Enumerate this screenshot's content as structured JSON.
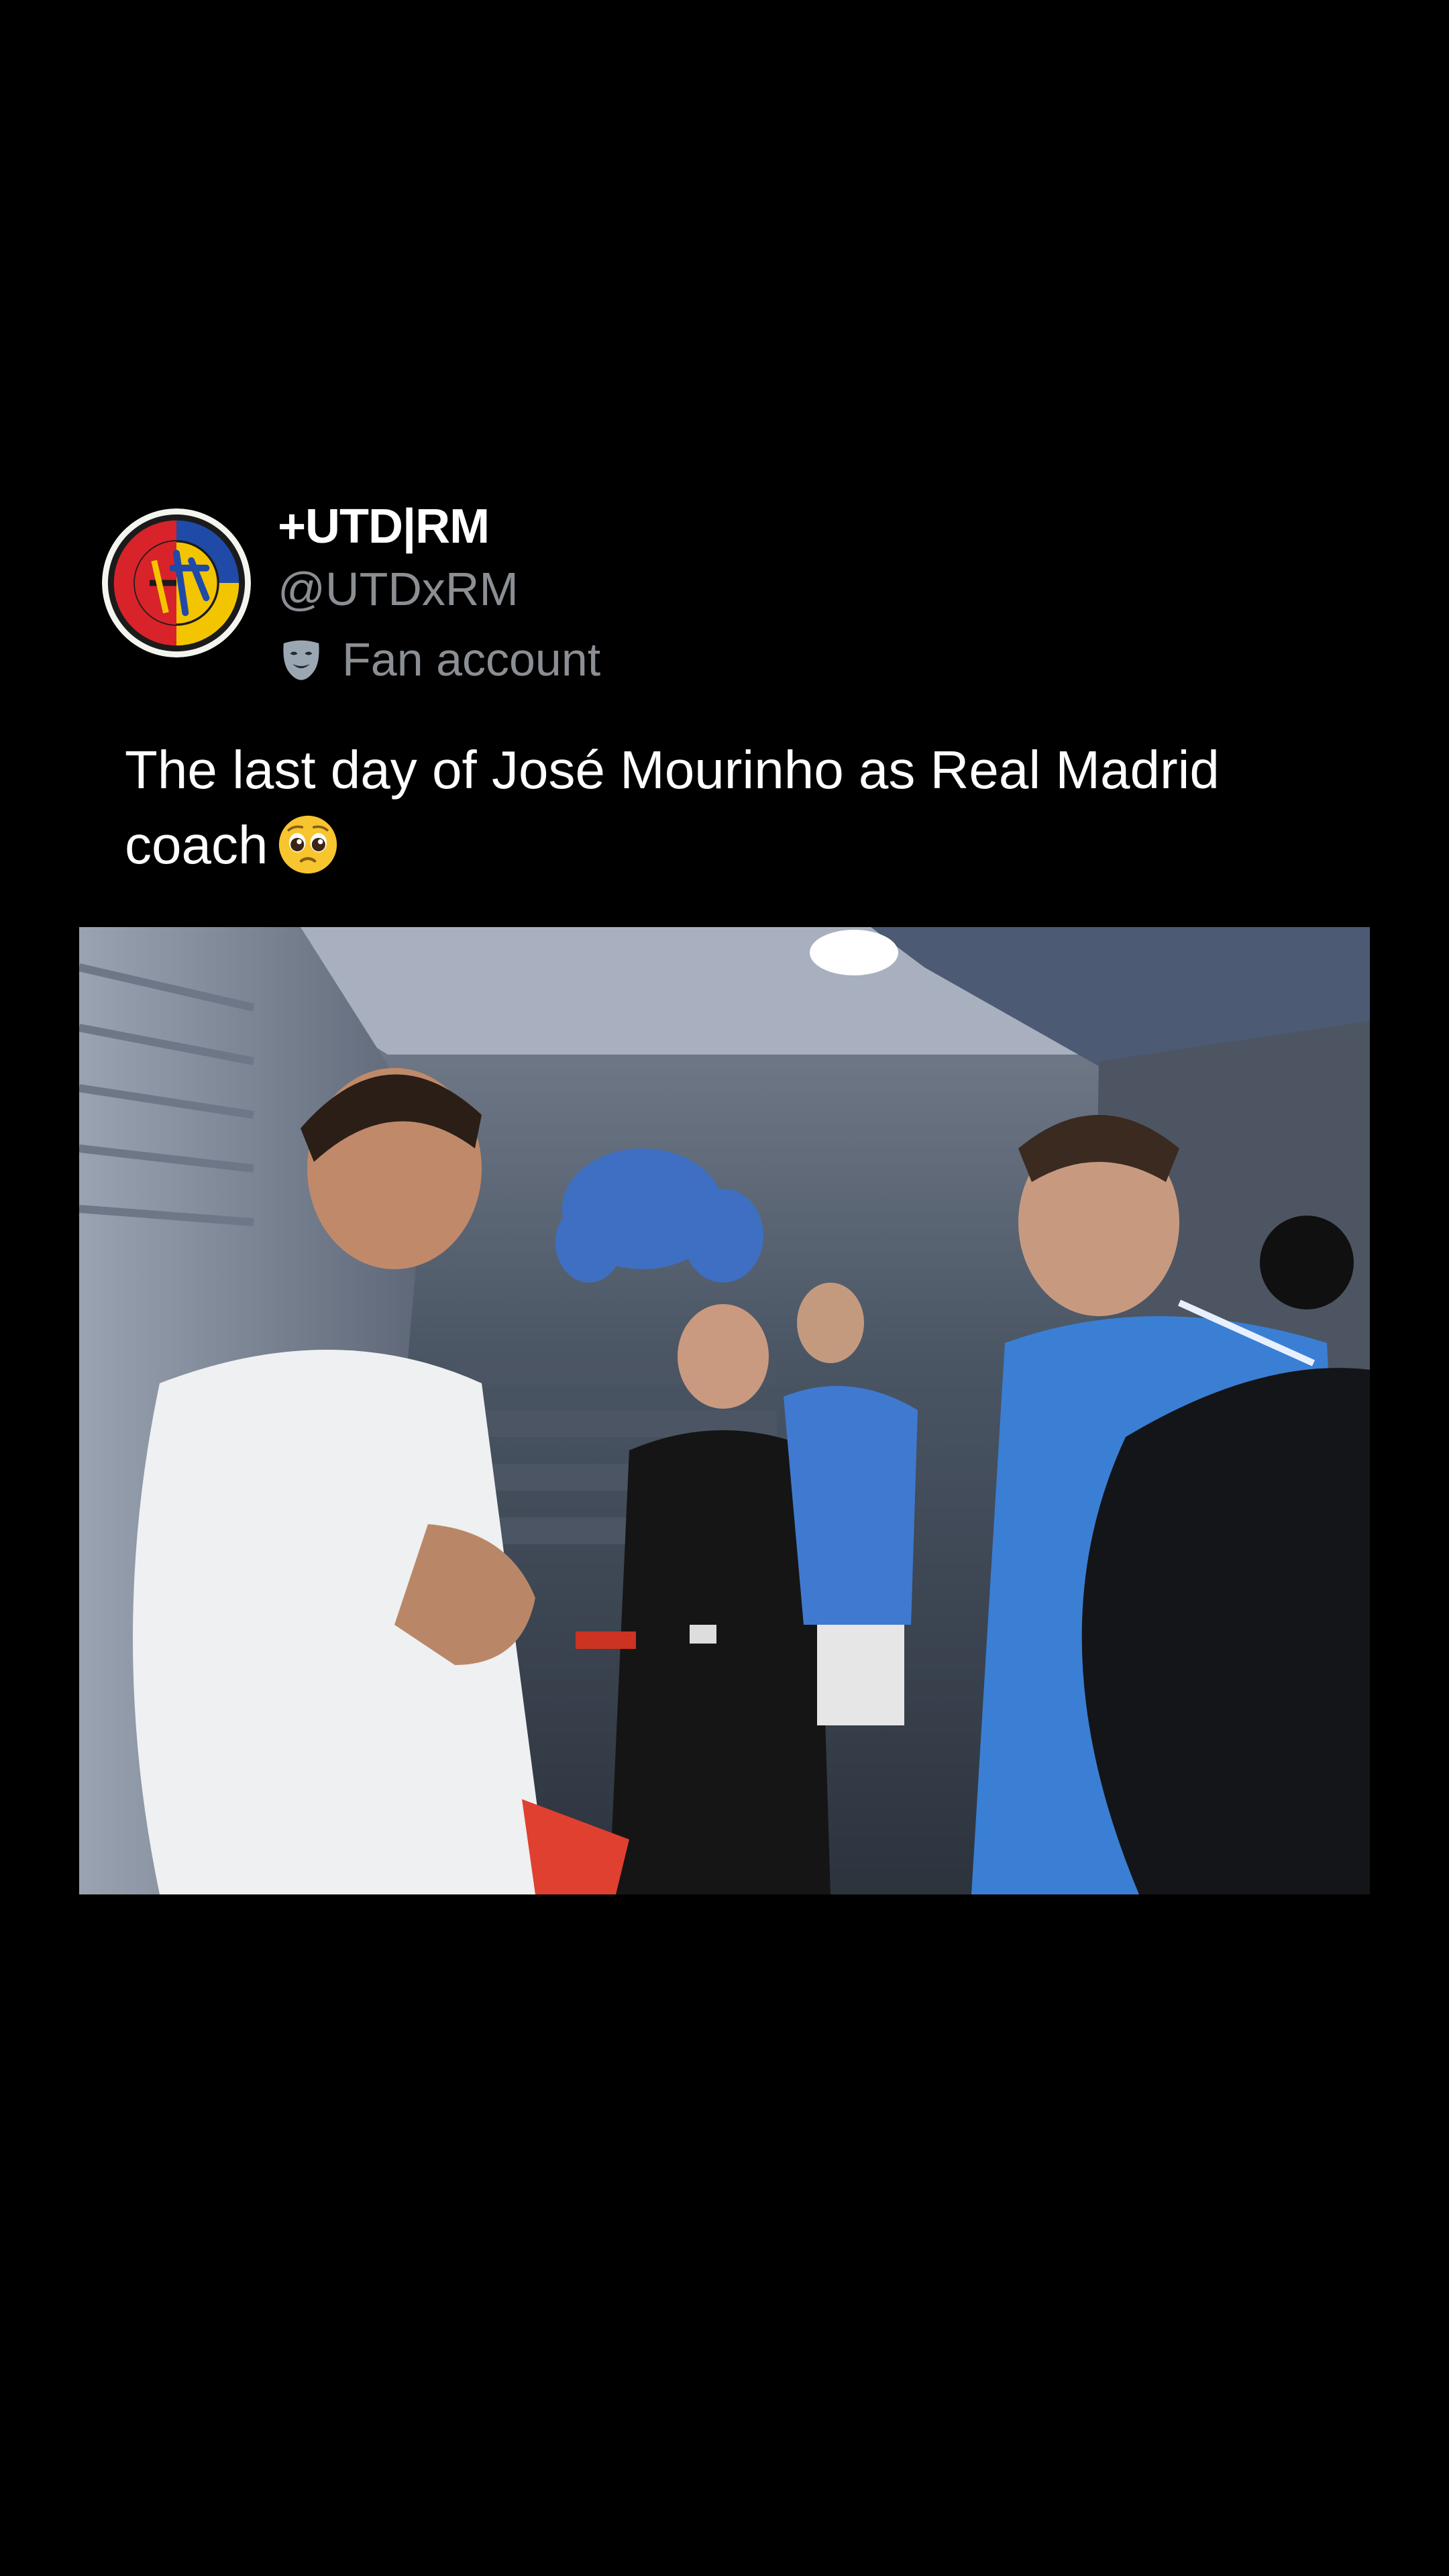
{
  "post": {
    "author": {
      "display_name": "+UTD|RM",
      "handle": "@UTDxRM",
      "account_label": "Fan account",
      "label_icon": "theater-mask-icon",
      "avatar_icon": "club-crest-avatar"
    },
    "text": "The last day of José Mourinho as Real Madrid coach",
    "emoji": "pleading-face-icon",
    "media": {
      "type": "video",
      "description_icon": "video-frame-tunnel-scene"
    }
  },
  "colors": {
    "background": "#000000",
    "primary_text": "#ffffff",
    "secondary_text": "#8b8f94"
  }
}
